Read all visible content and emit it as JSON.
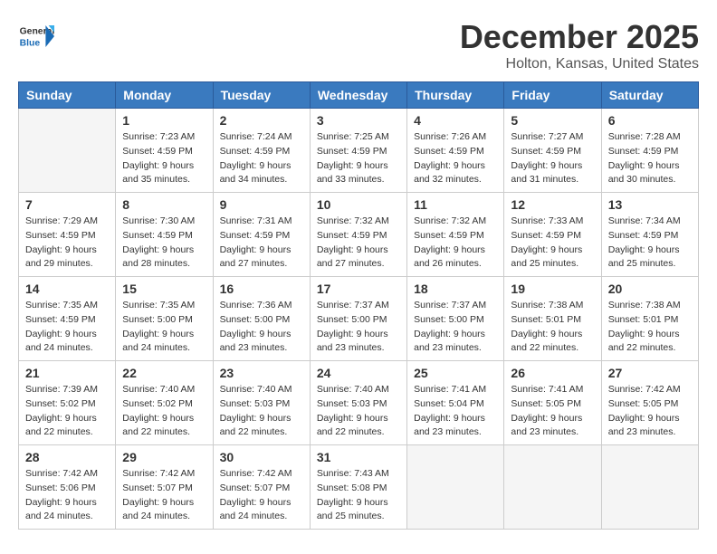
{
  "header": {
    "logo_general": "General",
    "logo_blue": "Blue",
    "month_title": "December 2025",
    "location": "Holton, Kansas, United States"
  },
  "weekdays": [
    "Sunday",
    "Monday",
    "Tuesday",
    "Wednesday",
    "Thursday",
    "Friday",
    "Saturday"
  ],
  "weeks": [
    [
      {
        "day": "",
        "empty": true,
        "info": ""
      },
      {
        "day": "1",
        "info": "Sunrise: 7:23 AM\nSunset: 4:59 PM\nDaylight: 9 hours\nand 35 minutes."
      },
      {
        "day": "2",
        "info": "Sunrise: 7:24 AM\nSunset: 4:59 PM\nDaylight: 9 hours\nand 34 minutes."
      },
      {
        "day": "3",
        "info": "Sunrise: 7:25 AM\nSunset: 4:59 PM\nDaylight: 9 hours\nand 33 minutes."
      },
      {
        "day": "4",
        "info": "Sunrise: 7:26 AM\nSunset: 4:59 PM\nDaylight: 9 hours\nand 32 minutes."
      },
      {
        "day": "5",
        "info": "Sunrise: 7:27 AM\nSunset: 4:59 PM\nDaylight: 9 hours\nand 31 minutes."
      },
      {
        "day": "6",
        "info": "Sunrise: 7:28 AM\nSunset: 4:59 PM\nDaylight: 9 hours\nand 30 minutes."
      }
    ],
    [
      {
        "day": "7",
        "info": "Sunrise: 7:29 AM\nSunset: 4:59 PM\nDaylight: 9 hours\nand 29 minutes."
      },
      {
        "day": "8",
        "info": "Sunrise: 7:30 AM\nSunset: 4:59 PM\nDaylight: 9 hours\nand 28 minutes."
      },
      {
        "day": "9",
        "info": "Sunrise: 7:31 AM\nSunset: 4:59 PM\nDaylight: 9 hours\nand 27 minutes."
      },
      {
        "day": "10",
        "info": "Sunrise: 7:32 AM\nSunset: 4:59 PM\nDaylight: 9 hours\nand 27 minutes."
      },
      {
        "day": "11",
        "info": "Sunrise: 7:32 AM\nSunset: 4:59 PM\nDaylight: 9 hours\nand 26 minutes."
      },
      {
        "day": "12",
        "info": "Sunrise: 7:33 AM\nSunset: 4:59 PM\nDaylight: 9 hours\nand 25 minutes."
      },
      {
        "day": "13",
        "info": "Sunrise: 7:34 AM\nSunset: 4:59 PM\nDaylight: 9 hours\nand 25 minutes."
      }
    ],
    [
      {
        "day": "14",
        "info": "Sunrise: 7:35 AM\nSunset: 4:59 PM\nDaylight: 9 hours\nand 24 minutes."
      },
      {
        "day": "15",
        "info": "Sunrise: 7:35 AM\nSunset: 5:00 PM\nDaylight: 9 hours\nand 24 minutes."
      },
      {
        "day": "16",
        "info": "Sunrise: 7:36 AM\nSunset: 5:00 PM\nDaylight: 9 hours\nand 23 minutes."
      },
      {
        "day": "17",
        "info": "Sunrise: 7:37 AM\nSunset: 5:00 PM\nDaylight: 9 hours\nand 23 minutes."
      },
      {
        "day": "18",
        "info": "Sunrise: 7:37 AM\nSunset: 5:00 PM\nDaylight: 9 hours\nand 23 minutes."
      },
      {
        "day": "19",
        "info": "Sunrise: 7:38 AM\nSunset: 5:01 PM\nDaylight: 9 hours\nand 22 minutes."
      },
      {
        "day": "20",
        "info": "Sunrise: 7:38 AM\nSunset: 5:01 PM\nDaylight: 9 hours\nand 22 minutes."
      }
    ],
    [
      {
        "day": "21",
        "info": "Sunrise: 7:39 AM\nSunset: 5:02 PM\nDaylight: 9 hours\nand 22 minutes."
      },
      {
        "day": "22",
        "info": "Sunrise: 7:40 AM\nSunset: 5:02 PM\nDaylight: 9 hours\nand 22 minutes."
      },
      {
        "day": "23",
        "info": "Sunrise: 7:40 AM\nSunset: 5:03 PM\nDaylight: 9 hours\nand 22 minutes."
      },
      {
        "day": "24",
        "info": "Sunrise: 7:40 AM\nSunset: 5:03 PM\nDaylight: 9 hours\nand 22 minutes."
      },
      {
        "day": "25",
        "info": "Sunrise: 7:41 AM\nSunset: 5:04 PM\nDaylight: 9 hours\nand 23 minutes."
      },
      {
        "day": "26",
        "info": "Sunrise: 7:41 AM\nSunset: 5:05 PM\nDaylight: 9 hours\nand 23 minutes."
      },
      {
        "day": "27",
        "info": "Sunrise: 7:42 AM\nSunset: 5:05 PM\nDaylight: 9 hours\nand 23 minutes."
      }
    ],
    [
      {
        "day": "28",
        "info": "Sunrise: 7:42 AM\nSunset: 5:06 PM\nDaylight: 9 hours\nand 24 minutes."
      },
      {
        "day": "29",
        "info": "Sunrise: 7:42 AM\nSunset: 5:07 PM\nDaylight: 9 hours\nand 24 minutes."
      },
      {
        "day": "30",
        "info": "Sunrise: 7:42 AM\nSunset: 5:07 PM\nDaylight: 9 hours\nand 24 minutes."
      },
      {
        "day": "31",
        "info": "Sunrise: 7:43 AM\nSunset: 5:08 PM\nDaylight: 9 hours\nand 25 minutes."
      },
      {
        "day": "",
        "empty": true,
        "info": ""
      },
      {
        "day": "",
        "empty": true,
        "info": ""
      },
      {
        "day": "",
        "empty": true,
        "info": ""
      }
    ]
  ]
}
